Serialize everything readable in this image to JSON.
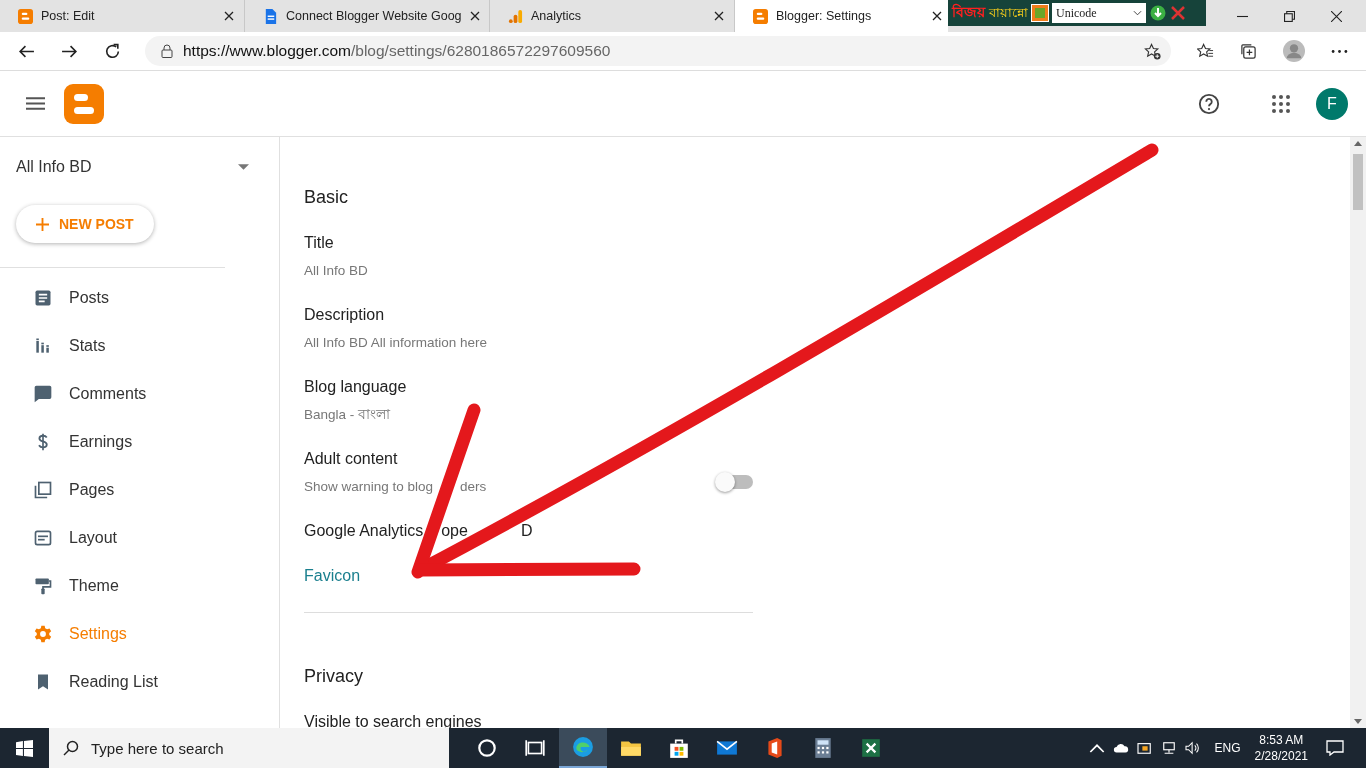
{
  "browser": {
    "tabs": [
      {
        "title": "Post: Edit",
        "kind": "blogger",
        "selected": false
      },
      {
        "title": "Connect Blogger Website Goog",
        "kind": "document",
        "selected": false
      },
      {
        "title": "Analytics",
        "kind": "analytics",
        "selected": false
      },
      {
        "title": "Blogger: Settings",
        "kind": "blogger",
        "selected": true
      }
    ],
    "url_host": "https://www.blogger.com",
    "url_path": "/blog/settings/6280186572297609560"
  },
  "keyboard_tool": {
    "logo_first": "বিজয়",
    "logo_second": "বায়ান্নো",
    "layout": "Unicode"
  },
  "header": {
    "avatar": "F"
  },
  "sidebar": {
    "blog_name": "All Info BD",
    "new_post": "NEW POST",
    "items": [
      {
        "label": "Posts",
        "kind": "posts",
        "selected": false
      },
      {
        "label": "Stats",
        "kind": "stats",
        "selected": false
      },
      {
        "label": "Comments",
        "kind": "comments",
        "selected": false
      },
      {
        "label": "Earnings",
        "kind": "earnings",
        "selected": false
      },
      {
        "label": "Pages",
        "kind": "pages",
        "selected": false
      },
      {
        "label": "Layout",
        "kind": "layout",
        "selected": false
      },
      {
        "label": "Theme",
        "kind": "theme",
        "selected": false
      },
      {
        "label": "Settings",
        "kind": "settings",
        "selected": true
      },
      {
        "label": "Reading List",
        "kind": "reading",
        "selected": false
      }
    ]
  },
  "sections": [
    {
      "title": "Basic",
      "items": [
        {
          "kind": "text",
          "label": "Title",
          "value": "All Info BD"
        },
        {
          "kind": "text",
          "label": "Description",
          "value": "All Info BD All information here"
        },
        {
          "kind": "text",
          "label": "Blog language",
          "value": "Bangla - বাংলা"
        },
        {
          "kind": "toggle",
          "label": "Adult content",
          "value_parts": [
            "Show warning to blog",
            "ders"
          ],
          "on": false
        },
        {
          "kind": "plain",
          "label_parts": [
            "Google Analytics",
            "ope",
            "D"
          ]
        },
        {
          "kind": "link",
          "label": "Favicon"
        }
      ]
    },
    {
      "title": "Privacy",
      "items": [
        {
          "kind": "plain",
          "label": "Visible to search engines"
        }
      ]
    }
  ],
  "taskbar": {
    "search_placeholder": "Type here to search",
    "language": "ENG",
    "time": "8:53 AM",
    "date": "2/28/2021"
  }
}
